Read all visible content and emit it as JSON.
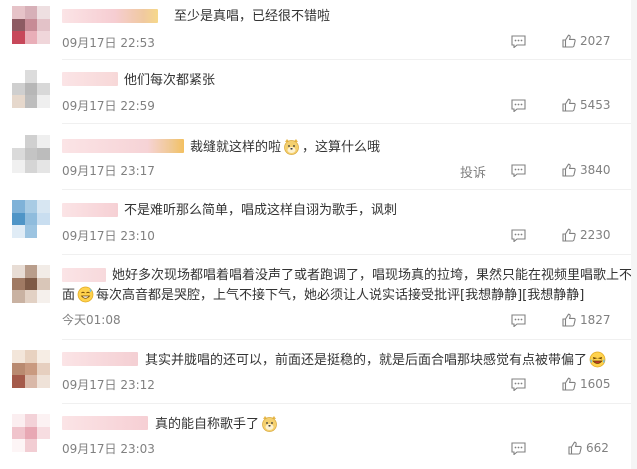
{
  "colors": {
    "text": "#333333",
    "meta": "#808080",
    "divider": "#f0f0f0"
  },
  "comments": [
    {
      "text": "至少是真唱，已经很不错啦",
      "time": "09月17日 22:53",
      "likes": "2027"
    },
    {
      "text": "他们每次都紧张",
      "time": "09月17日 22:59",
      "likes": "5453"
    },
    {
      "text_before": "裁缝就这样的啦",
      "emoji": "doge-emoji",
      "text_after": "，这算什么哦",
      "time": "09月17日 23:17",
      "report": "投诉",
      "likes": "3840"
    },
    {
      "text": "不是难听那么简单，唱成这样自诩为歌手，讽刺",
      "time": "09月17日 23:10",
      "likes": "2230"
    },
    {
      "line1": "她好多次现场都唱着唱着没声了或者跑调了，唱现场真的拉垮，果然只能在视频里唱歌上不了台",
      "line2_start": "面",
      "emoji": "sweat-smile-emoji",
      "line2_rest": "每次高音都是哭腔，上气不接下气，她必须让人说实话接受批评[我想静静][我想静静]",
      "time": "今天01:08",
      "likes": "1827"
    },
    {
      "text_before": "其实并胧唱的还可以，前面还是挺稳的，就是后面合唱那块感觉有点被带偏了",
      "emoji": "laugh-cry-emoji",
      "time": "09月17日 23:12",
      "likes": "1605"
    },
    {
      "text_before": "真的能自称歌手了",
      "emoji": "doge-emoji",
      "time": "09月17日 23:03",
      "likes": "662"
    }
  ]
}
